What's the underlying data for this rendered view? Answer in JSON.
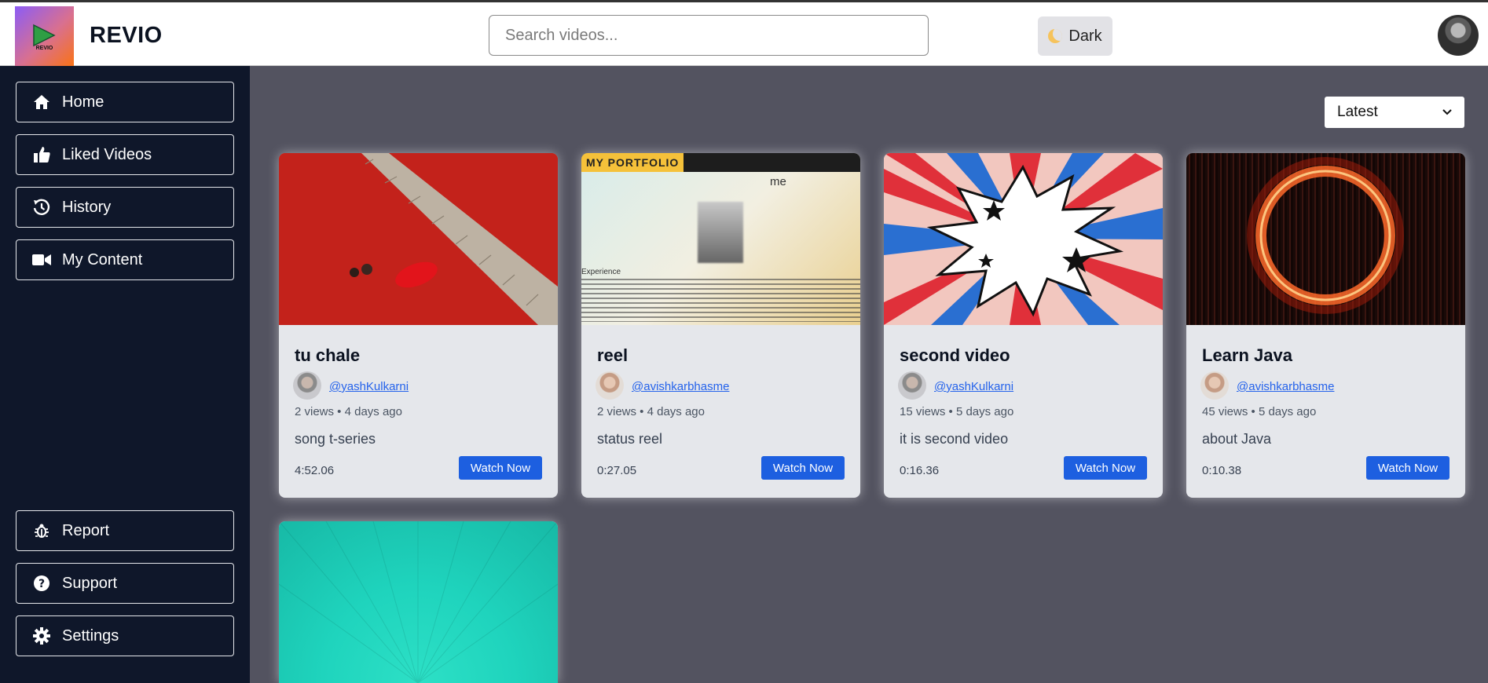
{
  "app": {
    "brand": "REVIO",
    "logo_text": "REVIO",
    "search_placeholder": "Search videos...",
    "theme_label": "Dark",
    "brand_gradient": [
      "#8b5cf6",
      "#f97316"
    ]
  },
  "sidebar": {
    "top_items": [
      {
        "label": "Home",
        "icon": "home-icon"
      },
      {
        "label": "Liked Videos",
        "icon": "thumbs-up-icon"
      },
      {
        "label": "History",
        "icon": "history-icon"
      },
      {
        "label": "My Content",
        "icon": "video-camera-icon"
      }
    ],
    "bottom_items": [
      {
        "label": "Report",
        "icon": "bug-icon"
      },
      {
        "label": "Support",
        "icon": "question-circle-icon"
      },
      {
        "label": "Settings",
        "icon": "gear-icon"
      }
    ]
  },
  "main": {
    "sort_selected": "Latest",
    "watch_label": "Watch Now",
    "videos": [
      {
        "title": "tu chale",
        "user": "@yashKulkarni",
        "meta": "2 views • 4 days ago",
        "description": "song t-series",
        "duration": "4:52.06"
      },
      {
        "title": "reel",
        "user": "@avishkarbhasme",
        "meta": "2 views • 4 days ago",
        "description": "status reel",
        "duration": "0:27.05",
        "thumb_text": "MY PORTFOLIO",
        "thumb_text2": "Experience",
        "thumb_text3": "me"
      },
      {
        "title": "second video",
        "user": "@yashKulkarni",
        "meta": "15 views • 5 days ago",
        "description": "it is second video",
        "duration": "0:16.36"
      },
      {
        "title": "Learn Java",
        "user": "@avishkarbhasme",
        "meta": "45 views • 5 days ago",
        "description": "about Java",
        "duration": "0:10.38"
      }
    ]
  },
  "colors": {
    "sidebar_bg": "#0f172a",
    "main_bg": "#535360",
    "accent": "#1d5fe0",
    "link": "#2563eb"
  }
}
